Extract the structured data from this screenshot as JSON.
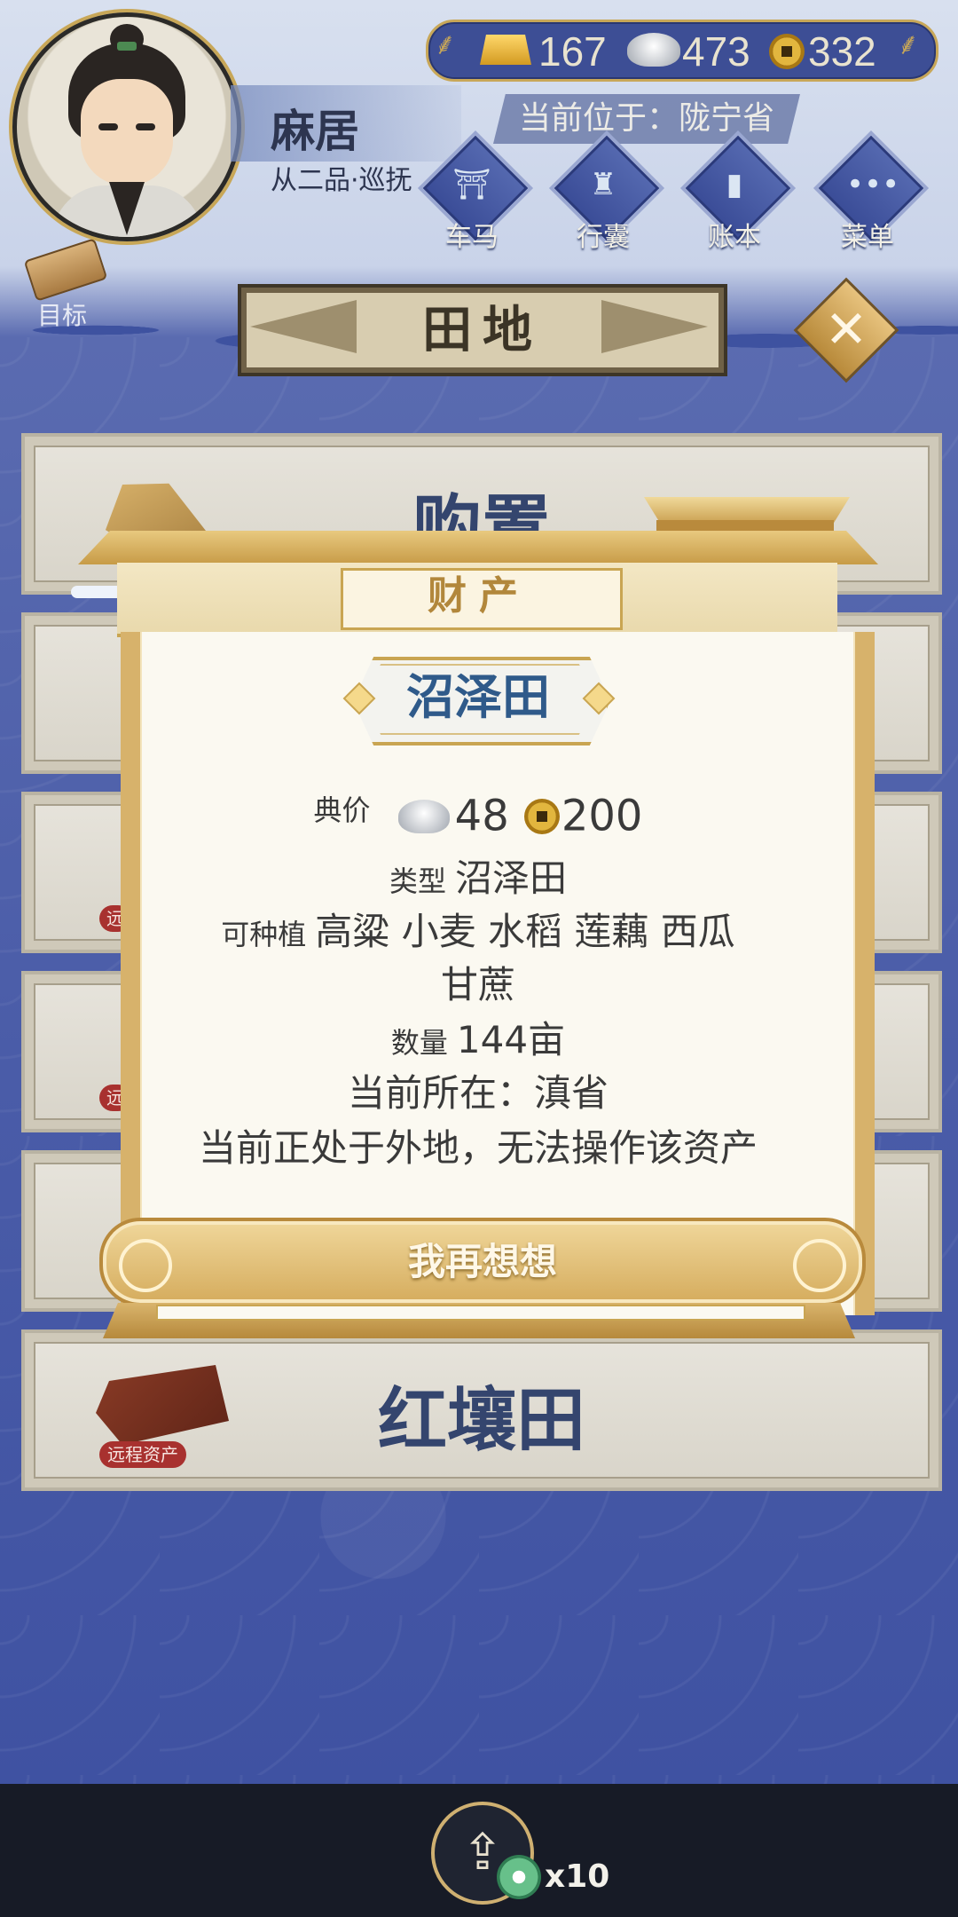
{
  "player": {
    "name": "麻居",
    "rank": "从二品·巡抚",
    "location": "当前位于：陇宁省"
  },
  "currency": {
    "gold": "167",
    "silver": "473",
    "copper": "332"
  },
  "menu": [
    {
      "label": "车马",
      "icon": "carriage-icon"
    },
    {
      "label": "行囊",
      "icon": "bag-icon"
    },
    {
      "label": "账本",
      "icon": "ledger-icon"
    },
    {
      "label": "菜单",
      "icon": "more-icon"
    }
  ],
  "target": {
    "label": "目标"
  },
  "page": {
    "title": "田地"
  },
  "list": {
    "buy_label": "购置",
    "red_soil_label": "红壤田",
    "remote_tag": "远程资产",
    "remote_tag_short": "远"
  },
  "modal": {
    "header": "财产",
    "asset_name": "沼泽田",
    "price_key": "典价",
    "price_silver": "48",
    "price_copper": "200",
    "type_key": "类型",
    "type_value": "沼泽田",
    "crops_key": "可种植",
    "crops_value_line1": "高粱 小麦 水稻 莲藕 西瓜",
    "crops_value_line2": "甘蔗",
    "qty_key": "数量",
    "qty_value": "144亩",
    "current_location": "当前所在：滇省",
    "warning": "当前正处于外地，无法操作该资产",
    "button": "我再想想"
  },
  "bottom": {
    "multiplier": "x10"
  },
  "colors": {
    "background": "#3f52a2",
    "gold_frame": "#c9a552",
    "title_blue": "#2f5a8a",
    "remote_tag": "#a8312f"
  }
}
